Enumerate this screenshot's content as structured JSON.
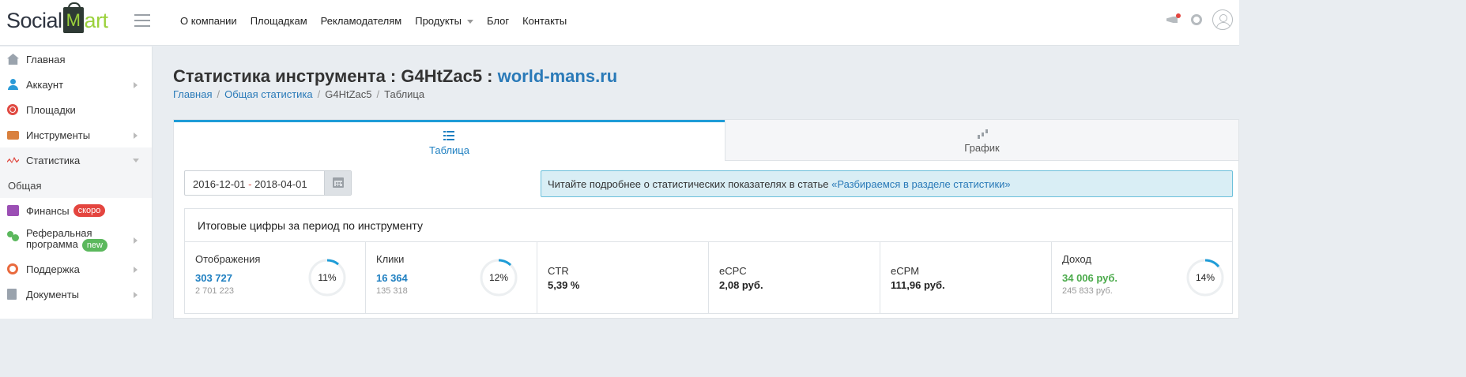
{
  "brand": {
    "part1": "Social",
    "part2": "M",
    "part3": "art"
  },
  "topnav": [
    "О компании",
    "Площадкам",
    "Рекламодателям",
    "Продукты",
    "Блог",
    "Контакты"
  ],
  "sidebar": {
    "items": [
      {
        "label": "Главная"
      },
      {
        "label": "Аккаунт"
      },
      {
        "label": "Площадки"
      },
      {
        "label": "Инструменты"
      },
      {
        "label": "Статистика"
      },
      {
        "label": "Общая"
      },
      {
        "label": "Финансы",
        "badge": "скоро"
      },
      {
        "label_line1": "Реферальная",
        "label_line2": "программа",
        "badge": "new"
      },
      {
        "label": "Поддержка"
      },
      {
        "label": "Документы"
      }
    ]
  },
  "page": {
    "title_prefix": "Статистика инструмента : G4HtZac5 : ",
    "title_link": "world-mans.ru",
    "breadcrumb": [
      "Главная",
      "Общая статистика",
      "G4HtZac5",
      "Таблица"
    ]
  },
  "tabs": [
    {
      "label": "Таблица"
    },
    {
      "label": "График"
    }
  ],
  "date_range": {
    "start": "2016-12-01",
    "separator": " - ",
    "end": "2018-04-01"
  },
  "info": {
    "text": "Читайте подробнее о статистических показателях в статье ",
    "link": "«Разбираемся в разделе статистики»"
  },
  "totals": {
    "header": "Итоговые цифры за период по инструменту",
    "cells": [
      {
        "name": "Отображения",
        "value": "303 727",
        "sub": "2 701 223",
        "percent_label": "11%",
        "percent": 11
      },
      {
        "name": "Клики",
        "value": "16 364",
        "sub": "135 318",
        "percent_label": "12%",
        "percent": 12
      },
      {
        "name": "CTR",
        "value": "5,39 %"
      },
      {
        "name": "eCPC",
        "value": "2,08 руб."
      },
      {
        "name": "eCPM",
        "value": "111,96 руб."
      },
      {
        "name": "Доход",
        "value": "34 006 руб.",
        "sub": "245 833 руб.",
        "percent_label": "14%",
        "percent": 14
      }
    ]
  },
  "colors": {
    "accent": "#1e9cd7",
    "link": "#2a7ab8",
    "green": "#4cab4c",
    "badge_red": "#e4453f",
    "badge_green": "#5bb85d"
  }
}
